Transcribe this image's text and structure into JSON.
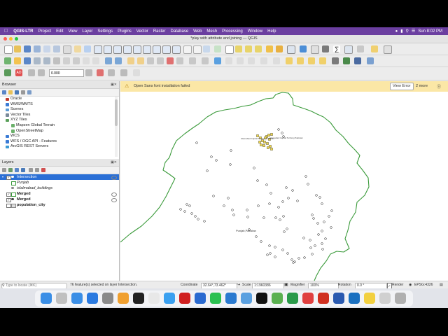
{
  "menubar": {
    "app_name": "QGIS-LTR",
    "items": [
      "Project",
      "Edit",
      "View",
      "Layer",
      "Settings",
      "Plugins",
      "Vector",
      "Raster",
      "Database",
      "Web",
      "Mesh",
      "Processing",
      "Window",
      "Help"
    ],
    "clock": "Sun 8:02 PM"
  },
  "window": {
    "title": "*play with attribute and joining — QGIS"
  },
  "toolbar": {
    "scale_value": "0.000"
  },
  "browser": {
    "title": "Browser",
    "items": [
      {
        "label": "Oracle",
        "icon": "oracle-icon",
        "indent": 1
      },
      {
        "label": "WMS/WMTS",
        "icon": "wms-icon",
        "indent": 1
      },
      {
        "label": "Scenes",
        "icon": "scenes-icon",
        "indent": 1
      },
      {
        "label": "Vector Tiles",
        "icon": "vector-tiles-icon",
        "indent": 1
      },
      {
        "label": "XYZ Tiles",
        "icon": "xyz-tiles-icon",
        "indent": 1
      },
      {
        "label": "Mapzen Global Terrain",
        "icon": "tile-icon",
        "indent": 2
      },
      {
        "label": "OpenStreetMap",
        "icon": "tile-icon",
        "indent": 2
      },
      {
        "label": "WCS",
        "icon": "wcs-icon",
        "indent": 1
      },
      {
        "label": "WFS / OGC API - Features",
        "icon": "wfs-icon",
        "indent": 1
      },
      {
        "label": "ArcGIS REST Servers",
        "icon": "arcgis-icon",
        "indent": 1
      }
    ]
  },
  "layers": {
    "title": "Layers",
    "items": [
      {
        "label": "Intersection",
        "checked": true,
        "selected": true,
        "italic": false,
        "bold": false,
        "symbol": "point",
        "indent": 0
      },
      {
        "label": "Punjab",
        "checked": false,
        "selected": false,
        "italic": true,
        "bold": false,
        "symbol": "polygon-green",
        "indent": 1
      },
      {
        "label": "islalmabad_buildings",
        "checked": false,
        "selected": false,
        "italic": true,
        "bold": false,
        "symbol": "point",
        "indent": 1
      },
      {
        "label": "Merged",
        "checked": true,
        "selected": false,
        "italic": false,
        "bold": true,
        "symbol": "polygon-green",
        "indent": 0
      },
      {
        "label": "Merged",
        "checked": true,
        "selected": false,
        "italic": false,
        "bold": true,
        "symbol": "point-dark",
        "indent": 0
      },
      {
        "label": "population_city",
        "checked": false,
        "selected": false,
        "italic": false,
        "bold": true,
        "symbol": "table",
        "indent": 0
      }
    ]
  },
  "message": {
    "text": "Open Sans font installation failed",
    "button": "View Error",
    "more": "2 more"
  },
  "map": {
    "label_punjab": "Punjab,Pakistan",
    "label_top_left": "Islamabad Capital Territory,Pakistan",
    "label_top_right": "Islamabad Capital Territory,Pakistan",
    "boundary_color": "#3a9a3a"
  },
  "status": {
    "locate_placeholder": "Type to locate (⌘K)",
    "message": "76 feature(s) selected on layer Intersection.",
    "coordinate_label": "Coordinate",
    "coordinate_value": "32.64°,73.462°",
    "scale_label": "Scale",
    "scale_value": "1:1960386",
    "magnifier_label": "Magnifier",
    "magnifier_value": "100%",
    "rotation_label": "Rotation",
    "rotation_value": "0.0 °",
    "render_label": "Render",
    "crs": "EPSG:4326"
  },
  "dock": {
    "apps": [
      "finder",
      "launchpad",
      "mail",
      "appstore",
      "settings",
      "photos",
      "terminal",
      "chrome",
      "safari",
      "acrobat",
      "zoom",
      "whatsapp",
      "vscode",
      "finder2",
      "tiktok",
      "qgis",
      "pycharm",
      "flow",
      "office",
      "word",
      "outlook",
      "notes",
      "preview",
      "trash"
    ]
  }
}
